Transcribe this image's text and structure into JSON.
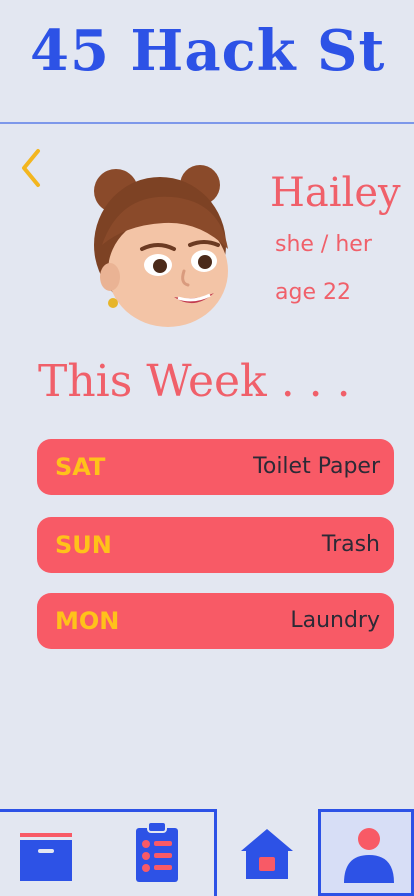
{
  "header": {
    "title": "45 Hack St"
  },
  "profile": {
    "name": "Hailey",
    "pronouns": "she / her",
    "age": "age 22"
  },
  "section": {
    "title": "This Week . . ."
  },
  "chores": [
    {
      "day": "SAT",
      "task": "Toilet Paper"
    },
    {
      "day": "SUN",
      "task": "Trash"
    },
    {
      "day": "MON",
      "task": "Laundry"
    }
  ],
  "colors": {
    "accent_blue": "#2d52e6",
    "chore_red": "#f85a66",
    "day_yellow": "#ffc21a",
    "text_pink": "#f0606a",
    "background": "#e3e7f1"
  },
  "icons": [
    "chevron-left-icon",
    "calendar-icon",
    "checklist-icon",
    "home-icon",
    "profile-icon"
  ]
}
